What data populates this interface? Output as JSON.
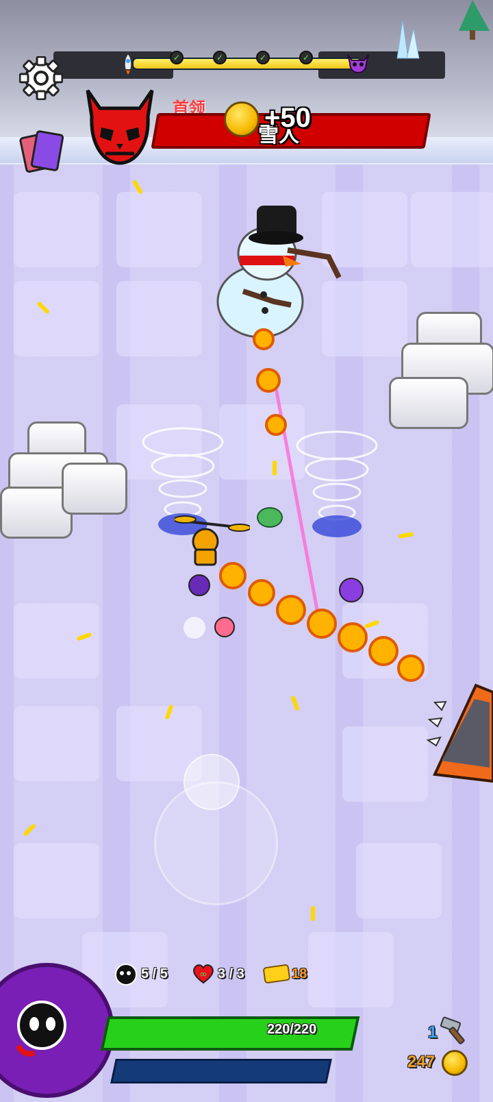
{
  "boss": {
    "label": "首领",
    "name": "雪人",
    "reward": "+50",
    "health_fraction": 1.0
  },
  "wave_progress": {
    "fraction": 1.0,
    "checkpoints": 4
  },
  "hud": {
    "bombs": "5 / 5",
    "lives": "3 / 3",
    "tickets": "18",
    "hp_text": "220/220",
    "hp_fraction": 1.0,
    "xp_fraction": 0.0,
    "hammers": "1",
    "coins": "247"
  },
  "icons": {
    "settings": "gear-icon",
    "cards": "cards-icon",
    "boss_portrait": "red-demon-skull-icon",
    "start": "rocket-icon",
    "end": "purple-demon-skull-icon",
    "bomb": "bomb-icon",
    "heart": "infinity-heart-icon",
    "ticket": "ticket-icon",
    "hammer": "hammer-icon",
    "coin": "coin-icon",
    "character": "ghost-character-icon"
  },
  "colors": {
    "boss_bar": "#d10000",
    "hp_bar": "#27d11a",
    "xp_bar": "#143a78",
    "progress_fill": "#f1c617",
    "progress_track": "#1f6fd8"
  }
}
